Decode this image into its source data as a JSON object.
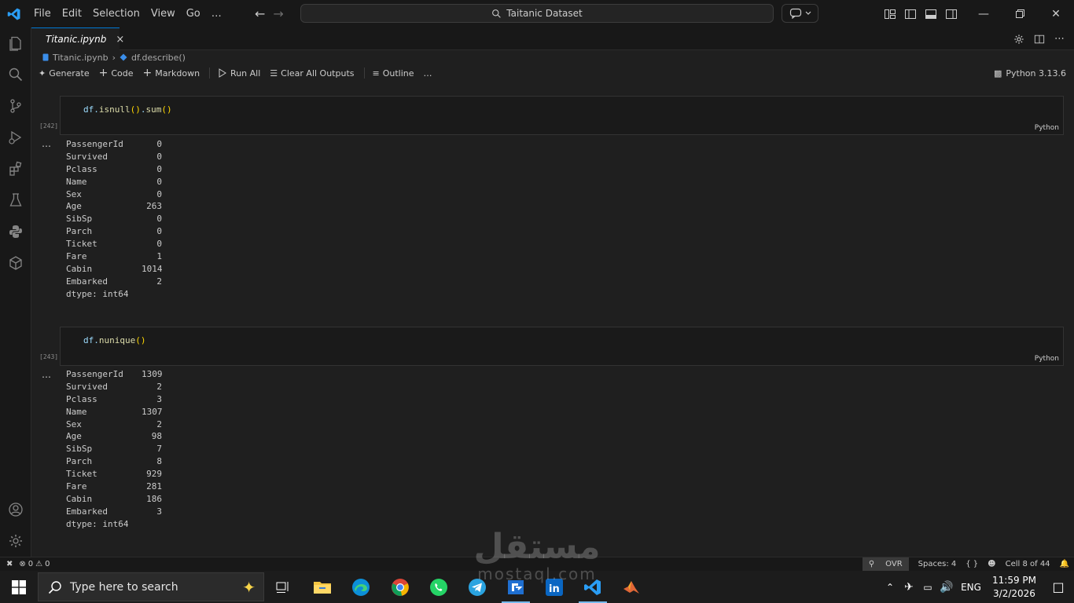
{
  "menu": {
    "items": [
      "File",
      "Edit",
      "Selection",
      "View",
      "Go",
      "…"
    ]
  },
  "search": {
    "label": "Taitanic Dataset"
  },
  "tab": {
    "title": "Titanic.ipynb",
    "close": "×"
  },
  "breadcrumb": {
    "file": "Titanic.ipynb",
    "symbol": "df.describe()",
    "sep": "›"
  },
  "toolbar": {
    "generate": "Generate",
    "code": "Code",
    "markdown": "Markdown",
    "run_all": "Run All",
    "clear_outputs": "Clear All Outputs",
    "outline": "Outline",
    "more": "…",
    "kernel": "Python 3.13.6"
  },
  "cells": [
    {
      "exec": "[242]",
      "code_obj": "df.",
      "code_fn1": "isnull",
      "code_p1": "()",
      "code_dot": ".",
      "code_fn2": "sum",
      "code_p2": "()",
      "lang": "Python",
      "dots": "…",
      "output": [
        {
          "k": "PassengerId",
          "v": "0"
        },
        {
          "k": "Survived",
          "v": "0"
        },
        {
          "k": "Pclass",
          "v": "0"
        },
        {
          "k": "Name",
          "v": "0"
        },
        {
          "k": "Sex",
          "v": "0"
        },
        {
          "k": "Age",
          "v": "263"
        },
        {
          "k": "SibSp",
          "v": "0"
        },
        {
          "k": "Parch",
          "v": "0"
        },
        {
          "k": "Ticket",
          "v": "0"
        },
        {
          "k": "Fare",
          "v": "1"
        },
        {
          "k": "Cabin",
          "v": "1014"
        },
        {
          "k": "Embarked",
          "v": "2"
        }
      ],
      "dtype": "dtype: int64"
    },
    {
      "exec": "[243]",
      "code_obj": "df.",
      "code_fn1": "nunique",
      "code_p1": "()",
      "code_dot": "",
      "code_fn2": "",
      "code_p2": "",
      "lang": "Python",
      "dots": "…",
      "output": [
        {
          "k": "PassengerId",
          "v": "1309"
        },
        {
          "k": "Survived",
          "v": "2"
        },
        {
          "k": "Pclass",
          "v": "3"
        },
        {
          "k": "Name",
          "v": "1307"
        },
        {
          "k": "Sex",
          "v": "2"
        },
        {
          "k": "Age",
          "v": "98"
        },
        {
          "k": "SibSp",
          "v": "7"
        },
        {
          "k": "Parch",
          "v": "8"
        },
        {
          "k": "Ticket",
          "v": "929"
        },
        {
          "k": "Fare",
          "v": "281"
        },
        {
          "k": "Cabin",
          "v": "186"
        },
        {
          "k": "Embarked",
          "v": "3"
        }
      ],
      "dtype": "dtype: int64"
    }
  ],
  "status": {
    "errors": "0",
    "warnings": "0",
    "ovr": "OVR",
    "spaces": "Spaces: 4",
    "braces": "{ }",
    "cell": "Cell 8 of 44"
  },
  "taskbar": {
    "search_placeholder": "Type here to search",
    "lang": "ENG",
    "time": "11:59 PM",
    "date": "3/2/2026"
  },
  "watermark": {
    "arabic": "مستقل",
    "latin": "mostaql.com"
  },
  "colors": {
    "accent": "#0078d4",
    "python_blue": "#3776ab",
    "python_yellow": "#ffd43b"
  }
}
